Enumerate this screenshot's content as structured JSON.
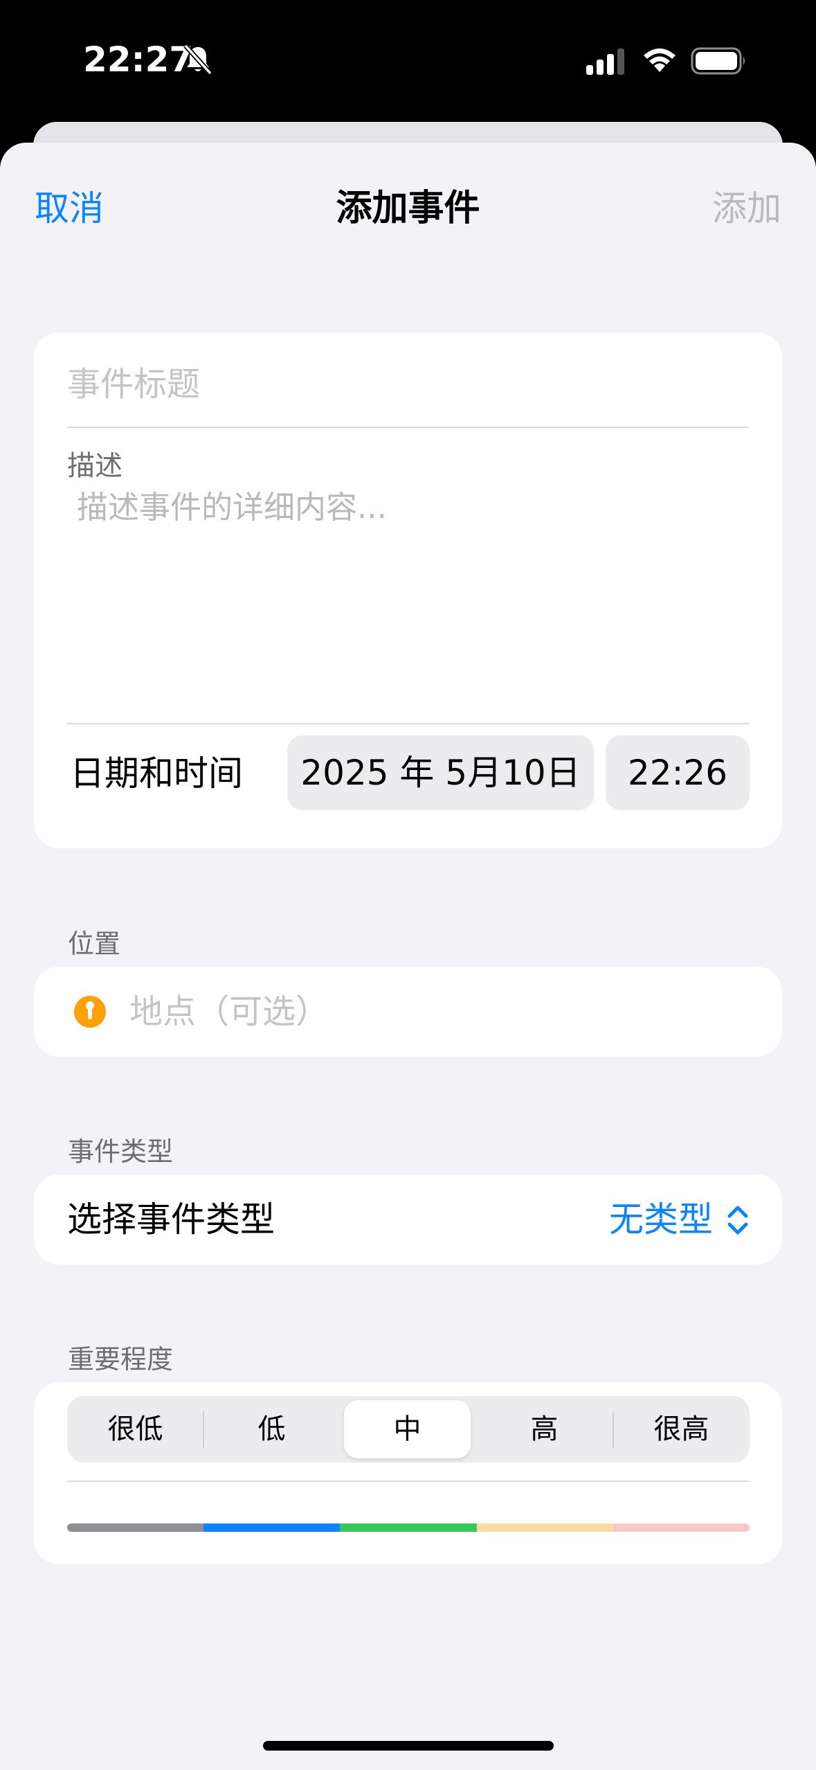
{
  "status_bar": {
    "time": "22:27",
    "icons": [
      "bell-slash-icon",
      "cellular-signal-icon",
      "wifi-icon",
      "battery-icon"
    ]
  },
  "nav": {
    "cancel_label": "取消",
    "title": "添加事件",
    "add_label": "添加"
  },
  "event": {
    "title_placeholder": "事件标题",
    "description_label": "描述",
    "description_placeholder": "描述事件的详细内容...",
    "datetime_label": "日期和时间",
    "date": "2025 年 5月10日",
    "time": "22:26"
  },
  "location": {
    "section_label": "位置",
    "icon": "location-pin-icon",
    "placeholder": "地点（可选）"
  },
  "event_type": {
    "section_label": "事件类型",
    "label": "选择事件类型",
    "value": "无类型"
  },
  "importance": {
    "section_label": "重要程度",
    "options": [
      "很低",
      "低",
      "中",
      "高",
      "很高"
    ],
    "selected": "中",
    "bar_colors": [
      "#8e8e93",
      "#0a84ff",
      "#34c759",
      "#fbdca0",
      "#f8c9c4"
    ]
  },
  "colors": {
    "accent": "#0a84ff",
    "background": "#f2f2f7"
  }
}
